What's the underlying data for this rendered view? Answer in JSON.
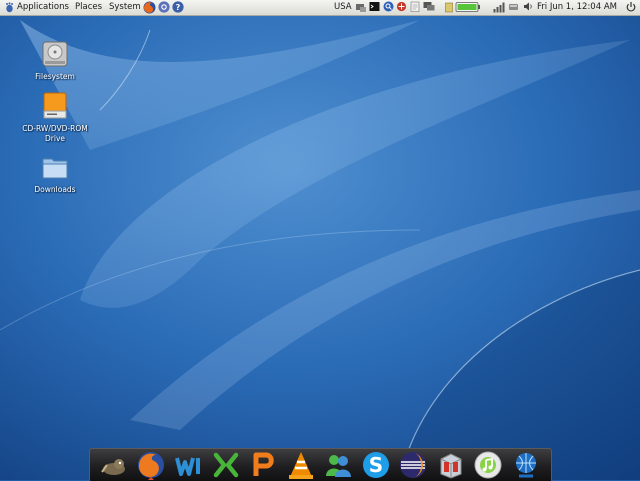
{
  "top_panel": {
    "menus": [
      "Applications",
      "Places",
      "System"
    ],
    "keyboard_layout": "USA",
    "clock": "Fri Jun  1, 12:04 AM",
    "icons": [
      "gnome-foot-icon",
      "firefox-icon",
      "email-icon",
      "help-icon",
      "network-icon",
      "terminal-icon",
      "search-icon",
      "update-icon",
      "clipboard-icon",
      "display-icon",
      "battery-icon",
      "signal-bars-icon",
      "volume-icon",
      "power-icon"
    ]
  },
  "desktop": {
    "icons": [
      {
        "label": "Filesystem",
        "icon": "hard-drive-icon"
      },
      {
        "label": "CD-RW/DVD-ROM Drive",
        "icon": "optical-drive-icon"
      },
      {
        "label": "Downloads",
        "icon": "folder-icon"
      }
    ]
  },
  "dock": {
    "items": [
      "gimp-icon",
      "firefox-icon",
      "writer-icon",
      "spreadsheet-icon",
      "presentation-icon",
      "vlc-icon",
      "messenger-icon",
      "skype-icon",
      "eclipse-icon",
      "archive-icon",
      "music-player-icon",
      "network-globe-icon"
    ]
  },
  "colors": {
    "wallpaper_base": "#1f5ea6",
    "panel": "#ececE8",
    "dock": "#1f1f21",
    "accent": "#3f8fd6"
  }
}
